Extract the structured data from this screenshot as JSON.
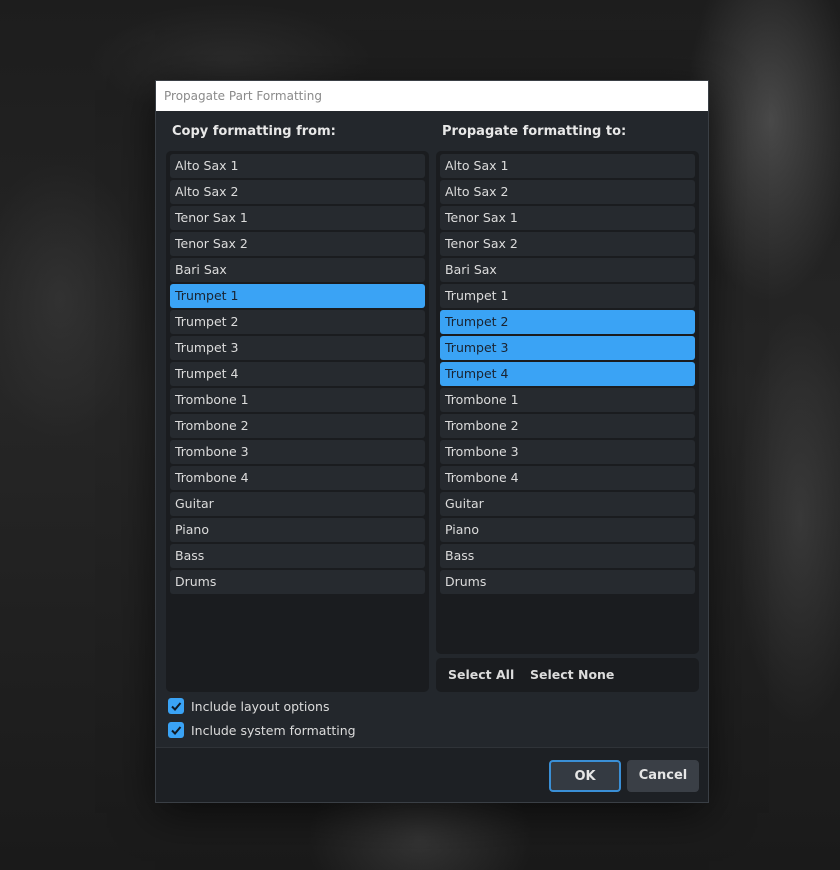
{
  "dialog": {
    "title": "Propagate Part Formatting",
    "from_label": "Copy formatting from:",
    "to_label": "Propagate formatting to:",
    "from_items": [
      {
        "label": "Alto Sax 1",
        "selected": false
      },
      {
        "label": "Alto Sax 2",
        "selected": false
      },
      {
        "label": "Tenor Sax 1",
        "selected": false
      },
      {
        "label": "Tenor Sax 2",
        "selected": false
      },
      {
        "label": "Bari Sax",
        "selected": false
      },
      {
        "label": "Trumpet 1",
        "selected": true
      },
      {
        "label": "Trumpet 2",
        "selected": false
      },
      {
        "label": "Trumpet 3",
        "selected": false
      },
      {
        "label": "Trumpet 4",
        "selected": false
      },
      {
        "label": "Trombone 1",
        "selected": false
      },
      {
        "label": "Trombone 2",
        "selected": false
      },
      {
        "label": "Trombone 3",
        "selected": false
      },
      {
        "label": "Trombone 4",
        "selected": false
      },
      {
        "label": "Guitar",
        "selected": false
      },
      {
        "label": "Piano",
        "selected": false
      },
      {
        "label": "Bass",
        "selected": false
      },
      {
        "label": "Drums",
        "selected": false
      }
    ],
    "to_items": [
      {
        "label": "Alto Sax 1",
        "selected": false
      },
      {
        "label": "Alto Sax 2",
        "selected": false
      },
      {
        "label": "Tenor Sax 1",
        "selected": false
      },
      {
        "label": "Tenor Sax 2",
        "selected": false
      },
      {
        "label": "Bari Sax",
        "selected": false
      },
      {
        "label": "Trumpet 1",
        "selected": false
      },
      {
        "label": "Trumpet 2",
        "selected": true
      },
      {
        "label": "Trumpet 3",
        "selected": true
      },
      {
        "label": "Trumpet 4",
        "selected": true
      },
      {
        "label": "Trombone 1",
        "selected": false
      },
      {
        "label": "Trombone 2",
        "selected": false
      },
      {
        "label": "Trombone 3",
        "selected": false
      },
      {
        "label": "Trombone 4",
        "selected": false
      },
      {
        "label": "Guitar",
        "selected": false
      },
      {
        "label": "Piano",
        "selected": false
      },
      {
        "label": "Bass",
        "selected": false
      },
      {
        "label": "Drums",
        "selected": false
      }
    ],
    "select_all_label": "Select All",
    "select_none_label": "Select None",
    "options": {
      "layout": {
        "label": "Include layout options",
        "checked": true
      },
      "system": {
        "label": "Include system formatting",
        "checked": true
      }
    },
    "ok_label": "OK",
    "cancel_label": "Cancel"
  },
  "colors": {
    "accent": "#3aa3f5",
    "dialog_bg": "#23272c",
    "list_bg": "#1a1c1f"
  }
}
